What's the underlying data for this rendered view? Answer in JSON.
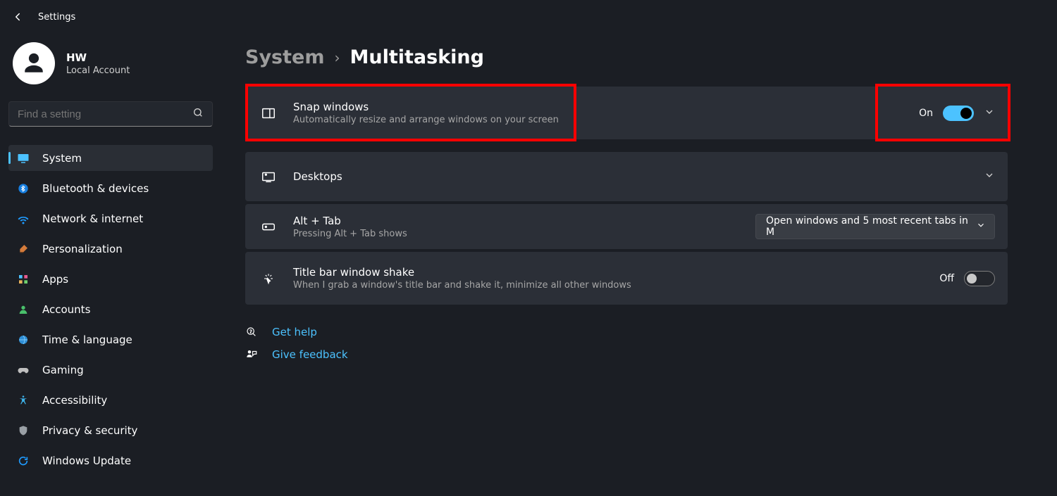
{
  "app_title": "Settings",
  "user": {
    "name": "HW",
    "subtitle": "Local Account"
  },
  "search": {
    "placeholder": "Find a setting"
  },
  "sidebar": {
    "items": [
      {
        "id": "system",
        "label": "System",
        "icon": "display-icon",
        "active": true
      },
      {
        "id": "bluetooth",
        "label": "Bluetooth & devices",
        "icon": "bluetooth-icon",
        "active": false
      },
      {
        "id": "network",
        "label": "Network & internet",
        "icon": "wifi-icon",
        "active": false
      },
      {
        "id": "personal",
        "label": "Personalization",
        "icon": "brush-icon",
        "active": false
      },
      {
        "id": "apps",
        "label": "Apps",
        "icon": "apps-icon",
        "active": false
      },
      {
        "id": "accounts",
        "label": "Accounts",
        "icon": "person-icon",
        "active": false
      },
      {
        "id": "time",
        "label": "Time & language",
        "icon": "globe-icon",
        "active": false
      },
      {
        "id": "gaming",
        "label": "Gaming",
        "icon": "gamepad-icon",
        "active": false
      },
      {
        "id": "accessibility",
        "label": "Accessibility",
        "icon": "accessibility-icon",
        "active": false
      },
      {
        "id": "privacy",
        "label": "Privacy & security",
        "icon": "shield-icon",
        "active": false
      },
      {
        "id": "update",
        "label": "Windows Update",
        "icon": "update-icon",
        "active": false
      }
    ]
  },
  "breadcrumb": {
    "parent": "System",
    "page": "Multitasking"
  },
  "cards": {
    "snap": {
      "title": "Snap windows",
      "subtitle": "Automatically resize and arrange windows on your screen",
      "state_label": "On",
      "on": true
    },
    "desktops": {
      "title": "Desktops"
    },
    "alttab": {
      "title": "Alt + Tab",
      "subtitle": "Pressing Alt + Tab shows",
      "dropdown": "Open windows and 5 most recent tabs in M"
    },
    "shake": {
      "title": "Title bar window shake",
      "subtitle": "When I grab a window's title bar and shake it, minimize all other windows",
      "state_label": "Off",
      "on": false
    }
  },
  "links": {
    "help": "Get help",
    "feedback": "Give feedback"
  },
  "colors": {
    "accent": "#4cc2ff",
    "highlight": "#ff0000"
  }
}
